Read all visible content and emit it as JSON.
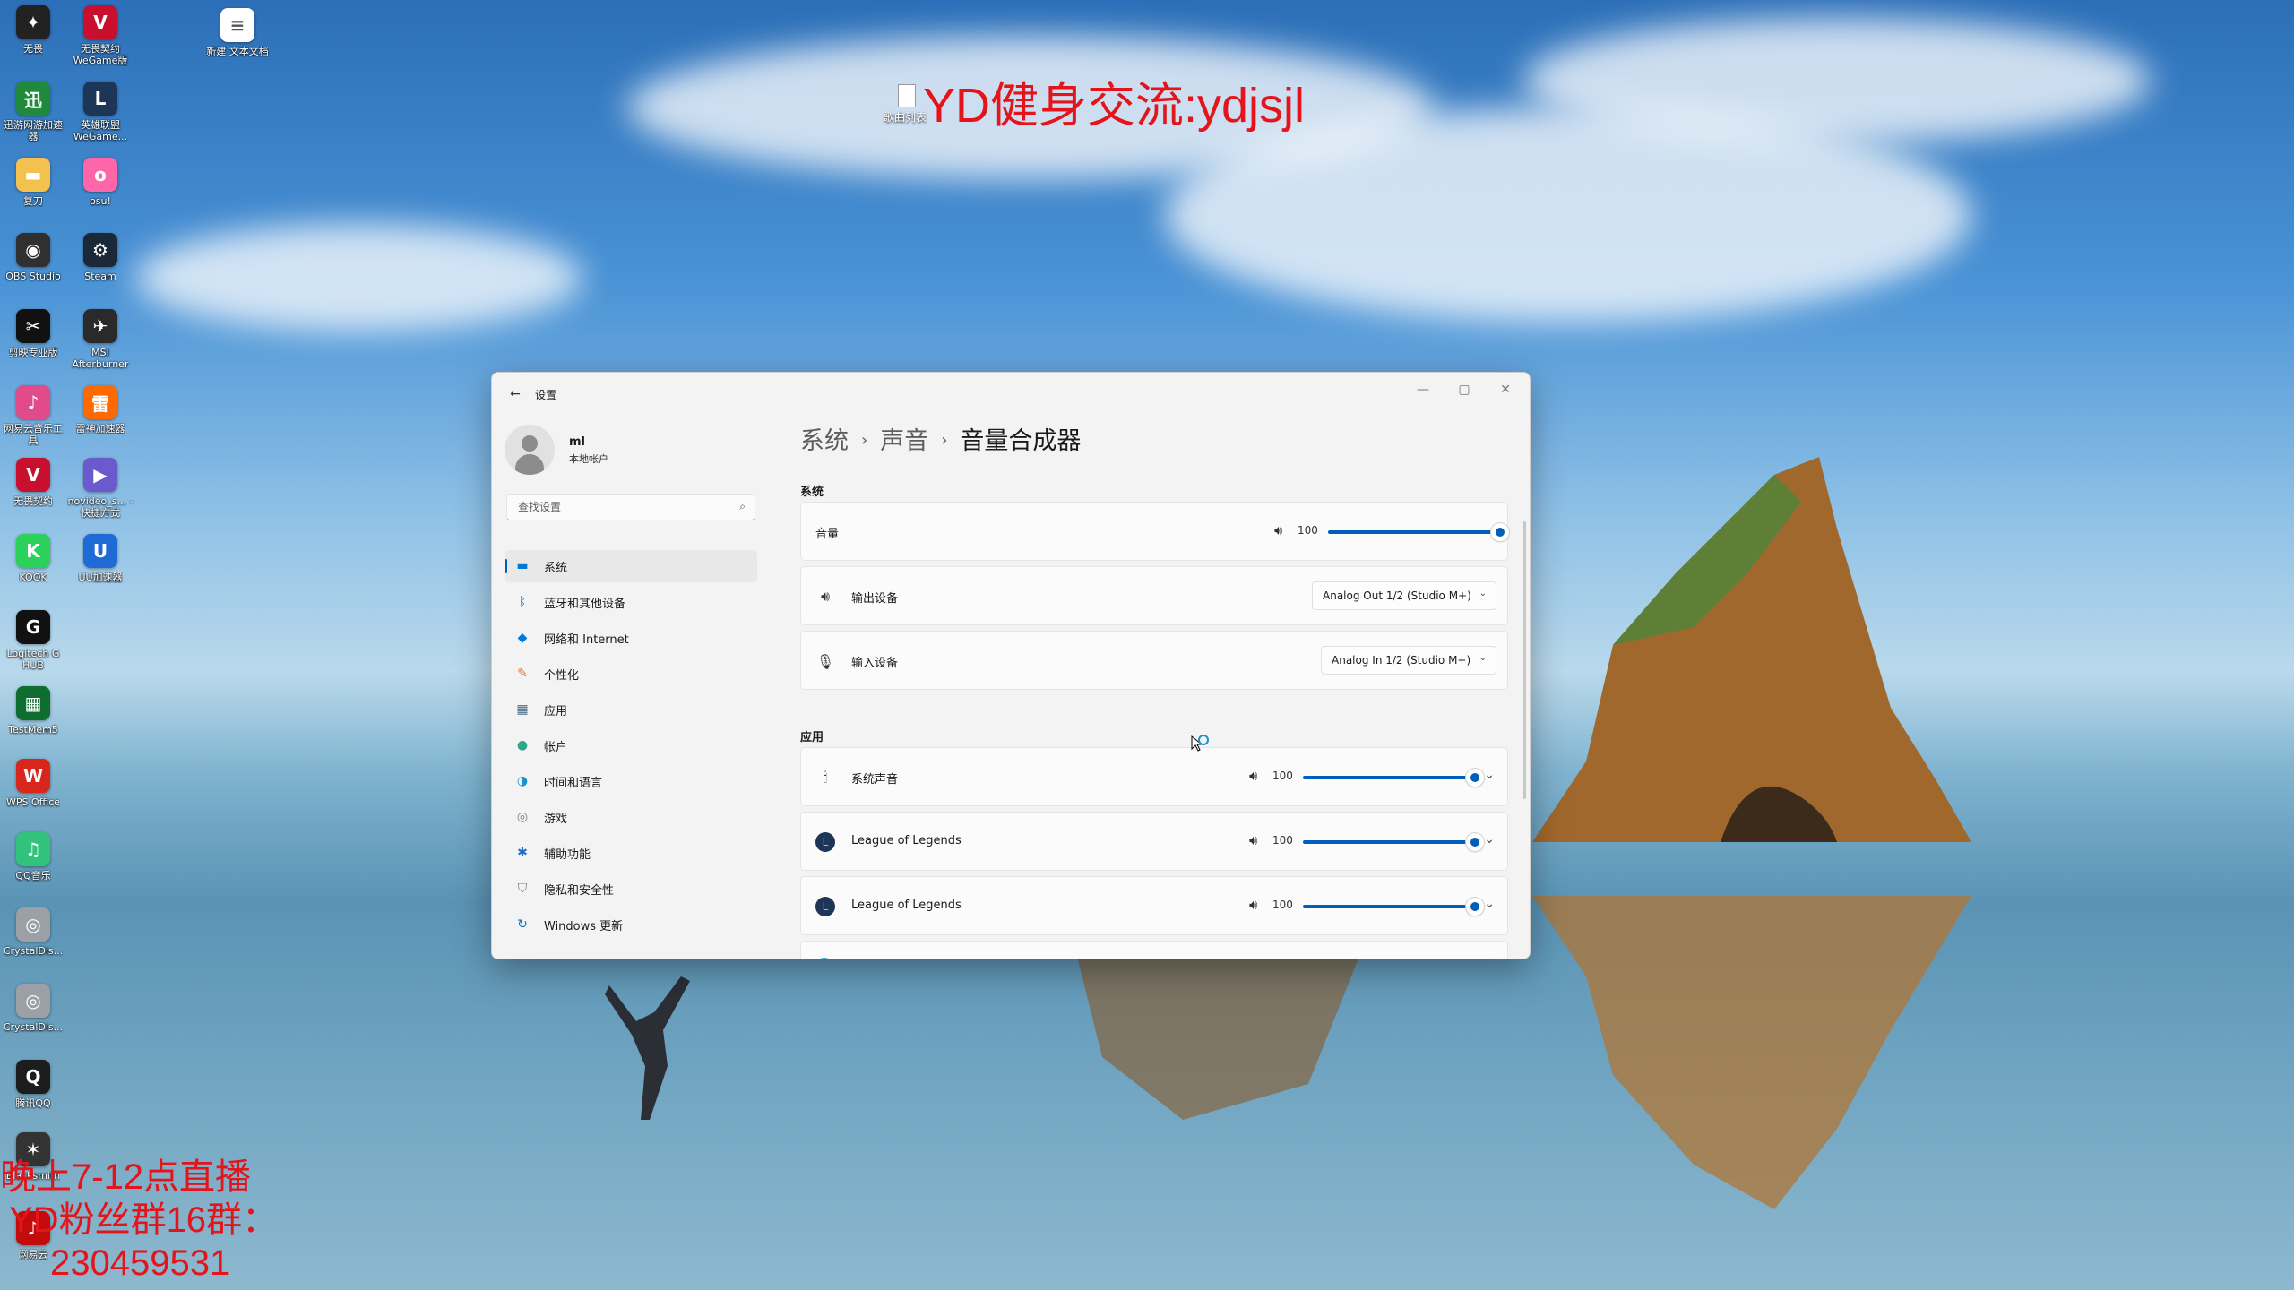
{
  "desktop": {
    "icons": [
      {
        "label": "无畏",
        "color": "#222222",
        "glyph": "✦"
      },
      {
        "label": "无畏契约 WeGame版",
        "color": "#c8102e",
        "glyph": "V"
      },
      {
        "label": "新建 文本文档",
        "color": "#ffffff",
        "glyph": "≡"
      },
      {
        "label": "迅游网游加速器",
        "color": "#1f8a3b",
        "glyph": "迅"
      },
      {
        "label": "英雄联盟 WeGame...",
        "color": "#1d3557",
        "glyph": "L"
      },
      {
        "label": "复刀",
        "color": "#f2c14e",
        "glyph": "▬"
      },
      {
        "label": "osu!",
        "color": "#ff66aa",
        "glyph": "o"
      },
      {
        "label": "OBS Studio",
        "color": "#303030",
        "glyph": "◉"
      },
      {
        "label": "Steam",
        "color": "#1b2838",
        "glyph": "⚙"
      },
      {
        "label": "剪映专业版",
        "color": "#111111",
        "glyph": "✂"
      },
      {
        "label": "MSI Afterburner",
        "color": "#2a2a2a",
        "glyph": "✈"
      },
      {
        "label": "网易云音乐工具",
        "color": "#e14b8a",
        "glyph": "♪"
      },
      {
        "label": "雷神加速器",
        "color": "#ff6a00",
        "glyph": "雷"
      },
      {
        "label": "无畏契约",
        "color": "#c8102e",
        "glyph": "V"
      },
      {
        "label": "novideo_s... - 快捷方式",
        "color": "#6a5acd",
        "glyph": "▶"
      },
      {
        "label": "KOOK",
        "color": "#2bd15a",
        "glyph": "K"
      },
      {
        "label": "UU加速器",
        "color": "#1e6bd6",
        "glyph": "U"
      },
      {
        "label": "Logitech G HUB",
        "color": "#111111",
        "glyph": "G"
      },
      {
        "label": "TestMem5",
        "color": "#0f6e2f",
        "glyph": "▦"
      },
      {
        "label": "WPS Office",
        "color": "#d9261c",
        "glyph": "W"
      },
      {
        "label": "QQ音乐",
        "color": "#31c27c",
        "glyph": "♫"
      },
      {
        "label": "CrystalDis...",
        "color": "#9aa0a6",
        "glyph": "◎"
      },
      {
        "label": "CrystalDis...",
        "color": "#9aa0a6",
        "glyph": "◎"
      },
      {
        "label": "腾讯QQ",
        "color": "#1d1d1d",
        "glyph": "Q"
      },
      {
        "label": "Blacksmith",
        "color": "#333333",
        "glyph": "✶"
      },
      {
        "label": "网易云",
        "color": "#c20c0c",
        "glyph": "♪"
      }
    ],
    "overlay_top": "YD健身交流:ydjsjl",
    "overlay_top_file_label": "歌曲列表",
    "overlay_bottom": [
      "晚上7-12点直播",
      "YD粉丝群16群：",
      "230459531"
    ]
  },
  "window": {
    "app_title": "设置",
    "back_icon": "arrow-left-icon",
    "controls": [
      "minimize",
      "maximize",
      "close"
    ],
    "profile": {
      "name": "ml",
      "subtitle": "本地帐户"
    },
    "search": {
      "placeholder": "查找设置"
    },
    "nav": [
      {
        "label": "系统",
        "icon": "monitor-icon",
        "color": "#0078d4",
        "glyph": "▬",
        "active": true
      },
      {
        "label": "蓝牙和其他设备",
        "icon": "bluetooth-icon",
        "color": "#0078d4",
        "glyph": "ᛒ",
        "active": false
      },
      {
        "label": "网络和 Internet",
        "icon": "wifi-icon",
        "color": "#0078d4",
        "glyph": "◆",
        "active": false
      },
      {
        "label": "个性化",
        "icon": "brush-icon",
        "color": "#e07b39",
        "glyph": "✎",
        "active": false
      },
      {
        "label": "应用",
        "icon": "apps-icon",
        "color": "#4a6b8a",
        "glyph": "▦",
        "active": false
      },
      {
        "label": "帐户",
        "icon": "person-icon",
        "color": "#2aa889",
        "glyph": "●",
        "active": false
      },
      {
        "label": "时间和语言",
        "icon": "globe-clock-icon",
        "color": "#1a8fd1",
        "glyph": "◑",
        "active": false
      },
      {
        "label": "游戏",
        "icon": "gamepad-icon",
        "color": "#7a7a7a",
        "glyph": "◎",
        "active": false
      },
      {
        "label": "辅助功能",
        "icon": "accessibility-icon",
        "color": "#1f6fc6",
        "glyph": "✱",
        "active": false
      },
      {
        "label": "隐私和安全性",
        "icon": "shield-icon",
        "color": "#7a7a7a",
        "glyph": "⛉",
        "active": false
      },
      {
        "label": "Windows 更新",
        "icon": "update-icon",
        "color": "#0078d4",
        "glyph": "↻",
        "active": false
      }
    ],
    "breadcrumb": [
      "系统",
      "声音",
      "音量合成器"
    ],
    "system_section": {
      "title": "系统",
      "volume": {
        "label": "音量",
        "value": "100",
        "level": 1.0
      },
      "output": {
        "label": "输出设备",
        "value": "Analog Out 1/2 (Studio M+)"
      },
      "input": {
        "label": "输入设备",
        "value": "Analog In 1/2 (Studio M+)"
      }
    },
    "apps_section": {
      "title": "应用",
      "apps": [
        {
          "label": "系统声音",
          "icon": "system-sounds-icon",
          "value": "100",
          "level": 1.0
        },
        {
          "label": "League of Legends",
          "icon": "league-of-legends-icon",
          "value": "100",
          "level": 1.0
        },
        {
          "label": "League of Legends",
          "icon": "league-of-legends-icon",
          "value": "100",
          "level": 1.0
        }
      ]
    }
  }
}
